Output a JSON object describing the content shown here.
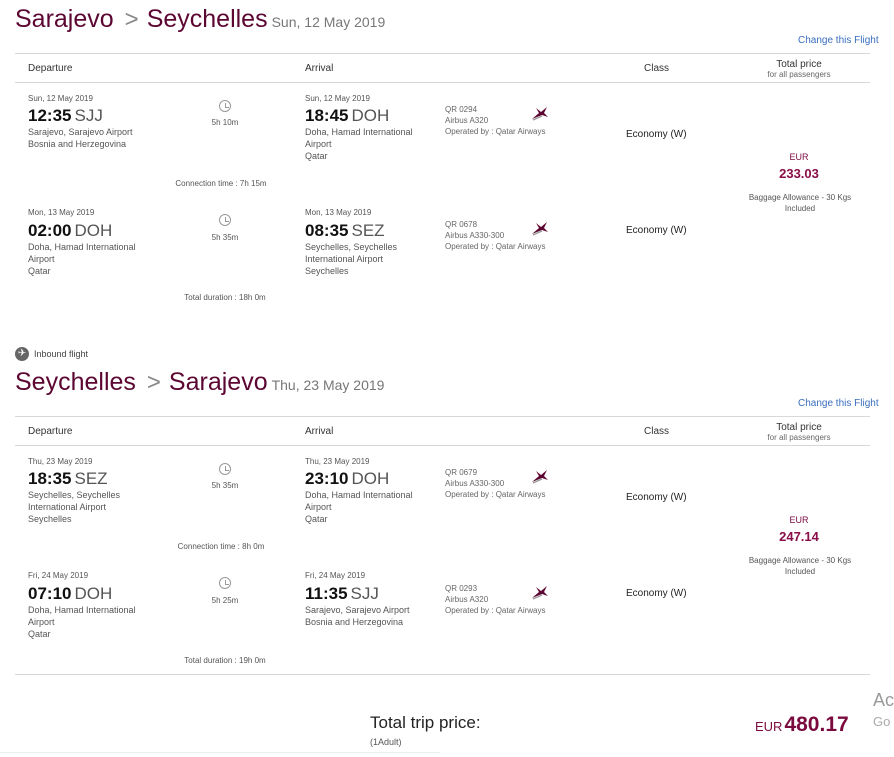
{
  "outbound": {
    "from": "Sarajevo",
    "to": "Seychelles",
    "date": "Sun, 12 May 2019",
    "change_link": "Change this Flight",
    "segments": [
      {
        "dep_date": "Sun, 12 May 2019",
        "dep_time": "12:35",
        "dep_code": "SJJ",
        "dep_place_1": "Sarajevo, Sarajevo Airport",
        "dep_place_2": "Bosnia and Herzegovina",
        "dep_place_3": "",
        "duration": "5h 10m",
        "arr_date": "Sun, 12 May 2019",
        "arr_time": "18:45",
        "arr_code": "DOH",
        "arr_place_1": "Doha, Hamad International",
        "arr_place_2": "Airport",
        "arr_place_3": "Qatar",
        "flight_no": "QR 0294",
        "aircraft": "Airbus A320",
        "operator": "Operated by : Qatar Airways",
        "class": "Economy (W)"
      },
      {
        "dep_date": "Mon, 13 May 2019",
        "dep_time": "02:00",
        "dep_code": "DOH",
        "dep_place_1": "Doha, Hamad International",
        "dep_place_2": "Airport",
        "dep_place_3": "Qatar",
        "duration": "5h 35m",
        "arr_date": "Mon, 13 May 2019",
        "arr_time": "08:35",
        "arr_code": "SEZ",
        "arr_place_1": "Seychelles, Seychelles",
        "arr_place_2": "International Airport",
        "arr_place_3": "Seychelles",
        "flight_no": "QR 0678",
        "aircraft": "Airbus A330-300",
        "operator": "Operated by : Qatar Airways",
        "class": "Economy (W)"
      }
    ],
    "connection": "Connection time : 7h 15m",
    "total_duration": "Total duration : 18h 0m",
    "currency": "EUR",
    "price": "233.03",
    "baggage_1": "Baggage Allowance - 30 Kgs",
    "baggage_2": "Included"
  },
  "inbound_label": "Inbound flight",
  "inbound": {
    "from": "Seychelles",
    "to": "Sarajevo",
    "date": "Thu, 23 May 2019",
    "change_link": "Change this Flight",
    "segments": [
      {
        "dep_date": "Thu, 23 May 2019",
        "dep_time": "18:35",
        "dep_code": "SEZ",
        "dep_place_1": "Seychelles, Seychelles",
        "dep_place_2": "International Airport",
        "dep_place_3": "Seychelles",
        "duration": "5h 35m",
        "arr_date": "Thu, 23 May 2019",
        "arr_time": "23:10",
        "arr_code": "DOH",
        "arr_place_1": "Doha, Hamad International",
        "arr_place_2": "Airport",
        "arr_place_3": "Qatar",
        "flight_no": "QR 0679",
        "aircraft": "Airbus A330-300",
        "operator": "Operated by : Qatar Airways",
        "class": "Economy (W)"
      },
      {
        "dep_date": "Fri, 24 May 2019",
        "dep_time": "07:10",
        "dep_code": "DOH",
        "dep_place_1": "Doha, Hamad International",
        "dep_place_2": "Airport",
        "dep_place_3": "Qatar",
        "duration": "5h 25m",
        "arr_date": "Fri, 24 May 2019",
        "arr_time": "11:35",
        "arr_code": "SJJ",
        "arr_place_1": "Sarajevo, Sarajevo Airport",
        "arr_place_2": "Bosnia and Herzegovina",
        "arr_place_3": "",
        "flight_no": "QR 0293",
        "aircraft": "Airbus A320",
        "operator": "Operated by : Qatar Airways",
        "class": "Economy (W)"
      }
    ],
    "connection": "Connection time : 8h 0m",
    "total_duration": "Total duration : 19h 0m",
    "currency": "EUR",
    "price": "247.14",
    "baggage_1": "Baggage Allowance - 30 Kgs",
    "baggage_2": "Included"
  },
  "headers": {
    "departure": "Departure",
    "arrival": "Arrival",
    "class": "Class",
    "total_price": "Total price",
    "for_all": "for all passengers"
  },
  "summary": {
    "label": "Total trip price:",
    "passengers": "(1Adult)",
    "currency": "EUR",
    "amount": "480.17"
  },
  "edge": {
    "line1": "Ac",
    "line2": "Go"
  },
  "colors": {
    "brand": "#5c0632",
    "price": "#8a0e47",
    "link": "#3a6ebd"
  }
}
